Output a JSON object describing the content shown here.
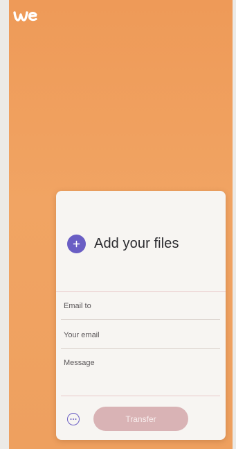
{
  "brand": {
    "logo_icon": "wetransfer-logo-icon",
    "background_color": "#f0a060",
    "accent_color": "#6a5ec4"
  },
  "upload": {
    "add_files_label": "Add your files",
    "add_icon": "plus-icon"
  },
  "form": {
    "email_to_placeholder": "Email to",
    "email_to_value": "",
    "your_email_placeholder": "Your email",
    "your_email_value": "",
    "message_placeholder": "Message",
    "message_value": ""
  },
  "footer": {
    "options_icon": "more-options-icon",
    "transfer_label": "Transfer"
  }
}
